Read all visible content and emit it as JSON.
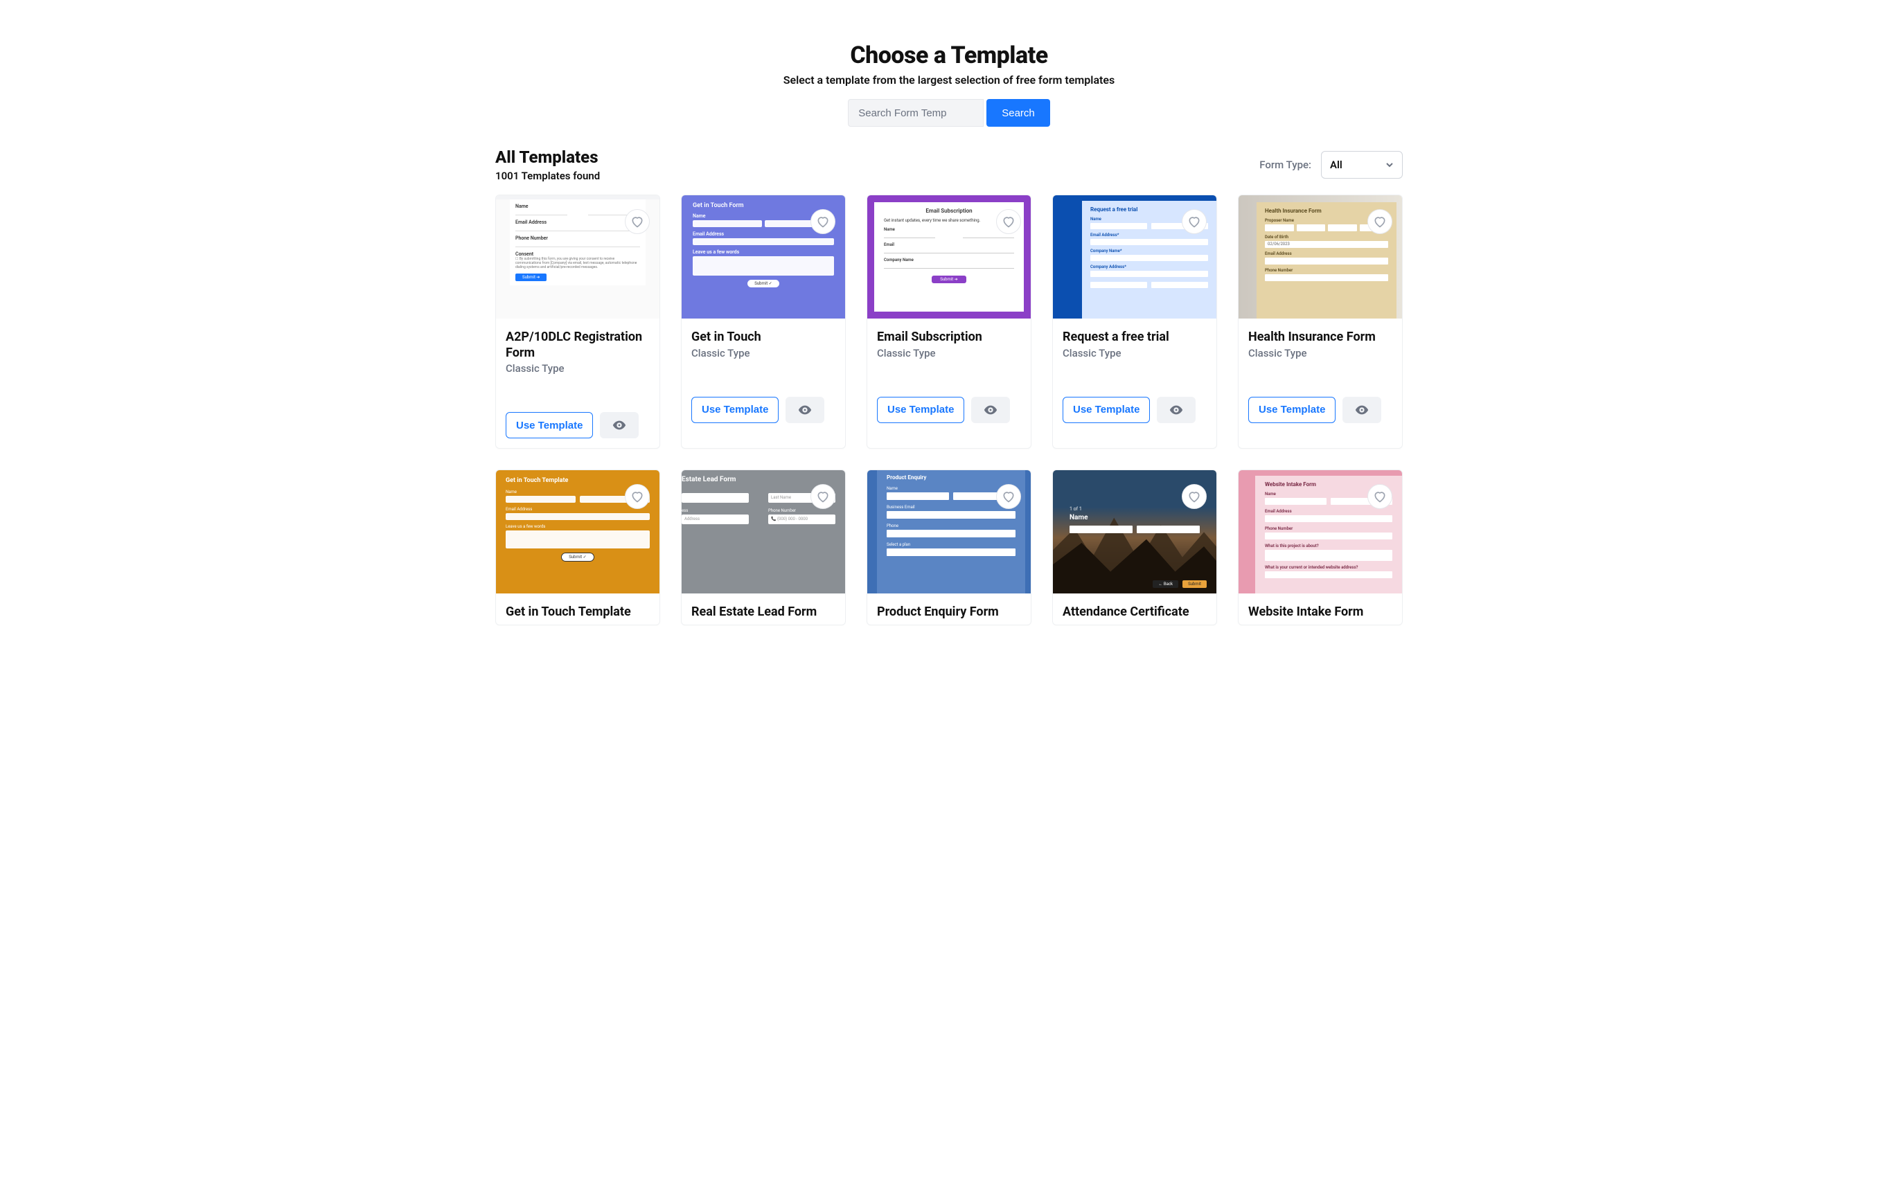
{
  "hero": {
    "title": "Choose a Template",
    "subtitle": "Select a template from the largest selection of free form templates",
    "search_placeholder": "Search Form Temp",
    "search_button": "Search"
  },
  "toolbar": {
    "heading": "All Templates",
    "count_text": "1001 Templates found",
    "form_type_label": "Form Type:",
    "form_type_value": "All"
  },
  "actions": {
    "use_template": "Use Template"
  },
  "templates": {
    "row1": {
      "t0": {
        "title": "A2P/10DLC Registration Form",
        "type": "Classic Type"
      },
      "t1": {
        "title": "Get in Touch",
        "type": "Classic Type"
      },
      "t2": {
        "title": "Email Subscription",
        "type": "Classic Type"
      },
      "t3": {
        "title": "Request a free trial",
        "type": "Classic Type"
      },
      "t4": {
        "title": "Health Insurance Form",
        "type": "Classic Type"
      }
    },
    "row2": {
      "t0": {
        "title": "Get in Touch Template"
      },
      "t1": {
        "title": "Real Estate Lead Form"
      },
      "t2": {
        "title": "Product Enquiry Form"
      },
      "t3": {
        "title": "Attendance Certificate"
      },
      "t4": {
        "title": "Website Intake Form"
      }
    }
  },
  "mocks": {
    "git": {
      "heading": "Get in Touch Form",
      "name": "Name",
      "email": "Email Address",
      "msg": "Leave us a few words",
      "btn": "Submit ✓"
    },
    "email": {
      "heading": "Email Subscription",
      "sub": "Get instant updates, every time we share something.",
      "name": "Name",
      "email": "Email",
      "company": "Company Name",
      "btn": "Submit ➔"
    },
    "trial": {
      "heading": "Request a free trial",
      "name": "Name",
      "email": "Email Address*",
      "company": "Company Name*",
      "addr": "Company Address*"
    },
    "health": {
      "heading": "Health Insurance Form",
      "prop": "Proposer Name",
      "dob": "Date of Birth",
      "dobv": "02/06/2023",
      "email": "Email Address",
      "phone": "Phone Number"
    },
    "a2p": {
      "name": "Name",
      "email": "Email Address",
      "phone": "Phone Number",
      "consent": "Consent",
      "submit": "Submit ➔"
    },
    "gito": {
      "heading": "Get in Touch Template",
      "name": "Name",
      "email": "Email Address",
      "msg": "Leave us a few words",
      "btn": "Submit ✓"
    },
    "re": {
      "heading": "Estate Lead Form",
      "lname": "Last Name",
      "phone": "Phone Number",
      "ess": "ess",
      "addr": "Address"
    },
    "pe": {
      "heading": "Product Enquiry",
      "name": "Name",
      "email": "Business Email",
      "phone": "Phone",
      "plan": "Select a plan"
    },
    "att": {
      "step": "1 of 1",
      "name": "Name",
      "back": "← Back",
      "submit": "Submit"
    },
    "wi": {
      "heading": "Website Intake Form",
      "name": "Name",
      "email": "Email Address",
      "phone": "Phone Number",
      "about": "What is this project is about?",
      "site": "What is your current or intended website address?"
    }
  }
}
